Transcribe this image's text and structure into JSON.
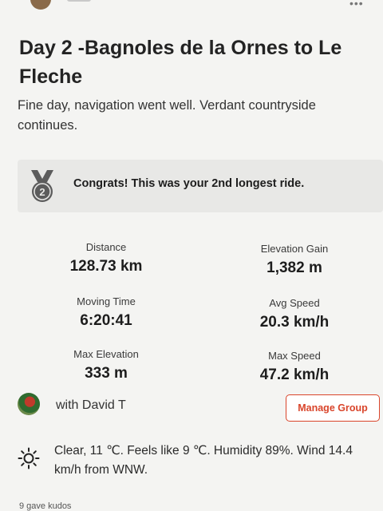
{
  "activity": {
    "title": "Day 2 -Bagnoles de la Ornes to Le Fleche",
    "description": "Fine day, navigation went well. Verdant countryside continues."
  },
  "achievement": {
    "badge_number": "2",
    "text": "Congrats! This was your 2nd longest ride."
  },
  "stats": {
    "distance": {
      "label": "Distance",
      "value": "128.73 km"
    },
    "elevation_gain": {
      "label": "Elevation Gain",
      "value": "1,382 m"
    },
    "moving_time": {
      "label": "Moving Time",
      "value": "6:20:41"
    },
    "avg_speed": {
      "label": "Avg Speed",
      "value": "20.3 km/h"
    },
    "max_elevation": {
      "label": "Max Elevation",
      "value": "333 m"
    },
    "max_speed": {
      "label": "Max Speed",
      "value": "47.2 km/h"
    }
  },
  "group": {
    "with_text": "with David T",
    "manage_label": "Manage Group"
  },
  "weather": {
    "icon": "sun-icon",
    "text": "Clear, 11 ℃. Feels like 9 ℃. Humidity 89%. Wind 14.4 km/h from WNW."
  },
  "kudos": {
    "text": "9 gave kudos"
  },
  "colors": {
    "accent": "#d9452b",
    "background": "#f4f4f2",
    "achievement_bg": "#e8e8e6",
    "medal": "#5c5c5c"
  }
}
